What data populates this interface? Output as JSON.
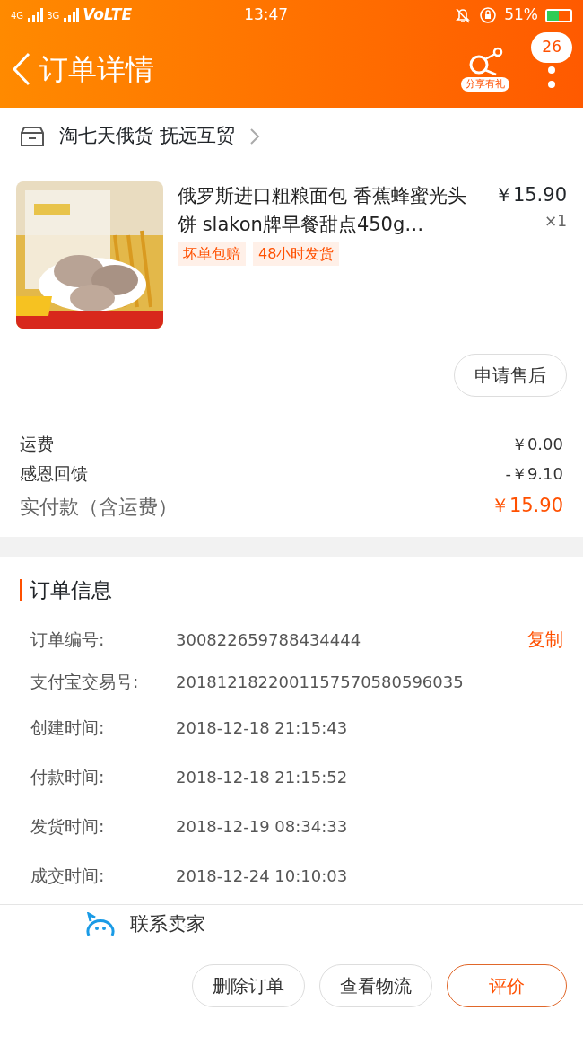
{
  "status_bar": {
    "signal_1": "4G",
    "signal_2": "3G",
    "network": "VoLTE",
    "time": "13:47",
    "battery": "51%"
  },
  "header": {
    "title": "订单详情",
    "share_label": "分享有礼",
    "message_count": "26"
  },
  "shop": {
    "name": "淘七天俄货 抚远互贸"
  },
  "product": {
    "kind": "picture",
    "title": "俄罗斯进口粗粮面包 香蕉蜂蜜光头饼 slakon牌早餐甜点450g…",
    "price": "￥15.90",
    "quantity": "×1",
    "tags": [
      "坏单包赔",
      "48小时发货"
    ],
    "after_sales_button": "申请售后"
  },
  "fees": [
    {
      "kind": "normal",
      "label": "运费",
      "value": "￥0.00"
    },
    {
      "kind": "normal",
      "label": "感恩回馈",
      "value": "-￥9.10"
    },
    {
      "kind": "total",
      "label": "实付款（含运费）",
      "value": "￥15.90"
    }
  ],
  "order_info": {
    "title": "订单信息",
    "copy_button": "复制",
    "rows": [
      {
        "label": "订单编号:",
        "value": "300822659788434444"
      },
      {
        "label": "支付宝交易号:",
        "value": "2018121822001157570580596035"
      },
      {
        "label": "创建时间:",
        "value": "2018-12-18 21:15:43"
      },
      {
        "label": "付款时间:",
        "value": "2018-12-18 21:15:52"
      },
      {
        "label": "发货时间:",
        "value": "2018-12-19 08:34:33"
      },
      {
        "label": "成交时间:",
        "value": "2018-12-24 10:10:03"
      }
    ]
  },
  "contact": {
    "label": "联系卖家"
  },
  "actions": [
    {
      "label": "删除订单",
      "primary": false
    },
    {
      "label": "查看物流",
      "primary": false
    },
    {
      "label": "评价",
      "primary": true
    }
  ]
}
